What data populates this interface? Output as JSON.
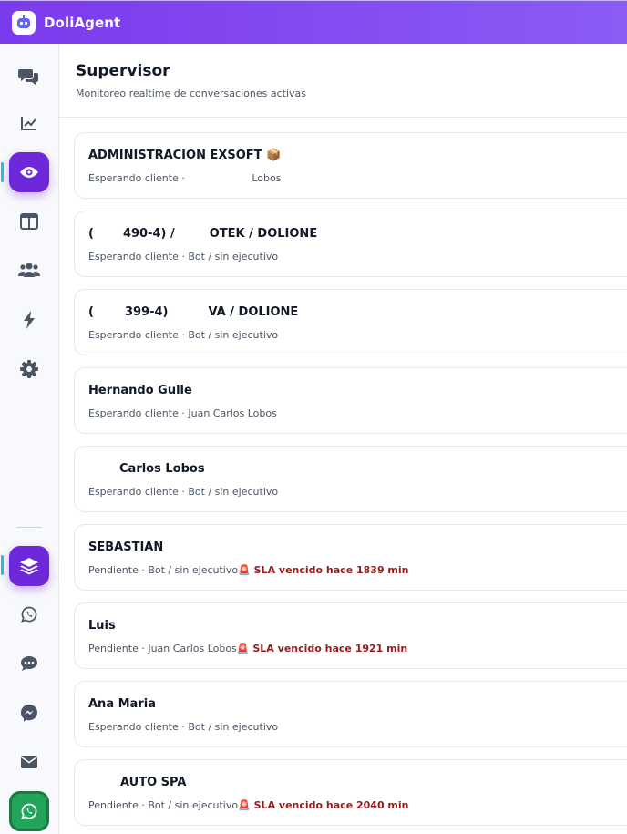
{
  "app": {
    "brand": "DoliAgent"
  },
  "sidebar": {
    "items": [
      {
        "name": "chat-icon"
      },
      {
        "name": "analytics-icon"
      },
      {
        "name": "eye-icon",
        "active": true
      },
      {
        "name": "layout-icon"
      },
      {
        "name": "users-icon"
      },
      {
        "name": "bolt-icon"
      },
      {
        "name": "gear-icon"
      }
    ],
    "channels": [
      {
        "name": "layers-icon",
        "active": true
      },
      {
        "name": "whatsapp-icon"
      },
      {
        "name": "message-bubble-icon"
      },
      {
        "name": "messenger-icon"
      },
      {
        "name": "mail-icon"
      },
      {
        "name": "whatsapp-icon",
        "highlight": true
      }
    ]
  },
  "header": {
    "title": "Supervisor",
    "subtitle": "Monitoreo realtime de conversaciones activas"
  },
  "conversations": [
    {
      "title_a": "ADMINISTRACION EXSOFT 📦",
      "title_b": "",
      "status": "Esperando cliente · ",
      "owner": "Lobos",
      "sla": ""
    },
    {
      "title_a": "(",
      "title_b": "490-4) /",
      "title_c": "OTEK / DOLIONE",
      "status": "Esperando cliente · ",
      "owner": "Bot / sin ejecutivo",
      "sla": ""
    },
    {
      "title_a": "(",
      "title_b": "399-4)",
      "title_c": "VA / DOLIONE",
      "status": "Esperando cliente · ",
      "owner": "Bot / sin ejecutivo",
      "sla": ""
    },
    {
      "title_a": "Hernando Gulle",
      "title_b": "",
      "status": "Esperando cliente · ",
      "owner": "Juan Carlos Lobos",
      "sla": ""
    },
    {
      "title_a": "Carlos Lobos",
      "title_b": "",
      "status": "Esperando cliente · ",
      "owner": "Bot / sin ejecutivo",
      "sla": ""
    },
    {
      "title_a": "SEBASTIAN",
      "title_b": "",
      "status": "Pendiente · ",
      "owner": "Bot / sin ejecutivo",
      "sla": "🚨 SLA vencido hace 1839 min"
    },
    {
      "title_a": "Luis",
      "title_b": "",
      "status": "Pendiente · ",
      "owner": "Juan Carlos Lobos",
      "sla": "🚨 SLA vencido hace 1921 min"
    },
    {
      "title_a": "Ana Maria",
      "title_b": "",
      "status": "Esperando cliente · ",
      "owner": "Bot / sin ejecutivo",
      "sla": ""
    },
    {
      "title_a": "AUTO SPA",
      "title_b": "",
      "status": "Pendiente · ",
      "owner": "Bot / sin ejecutivo",
      "sla": "🚨 SLA vencido hace 2040 min"
    }
  ]
}
